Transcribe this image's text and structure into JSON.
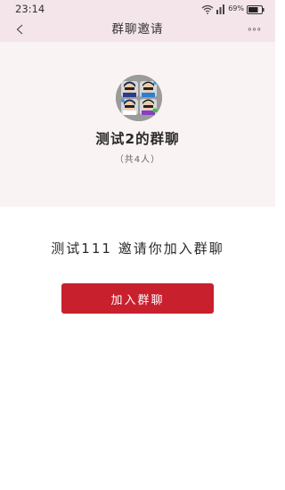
{
  "status_bar": {
    "time": "23:14",
    "battery_percent": "69%",
    "icons": [
      "wifi-icon",
      "signal-icon",
      "battery-icon"
    ]
  },
  "nav": {
    "back_label": "<",
    "title": "群聊邀请",
    "more_label": "∘∘∘"
  },
  "group": {
    "name": "测试2的群聊",
    "member_count": "（共4人）"
  },
  "invite": {
    "message": "测试111 邀请你加入群聊",
    "join_button_label": "加入群聊"
  },
  "colors": {
    "header_bg": "#f4e5ea",
    "card_bg": "#faf3f3",
    "accent": "#c8202d"
  }
}
